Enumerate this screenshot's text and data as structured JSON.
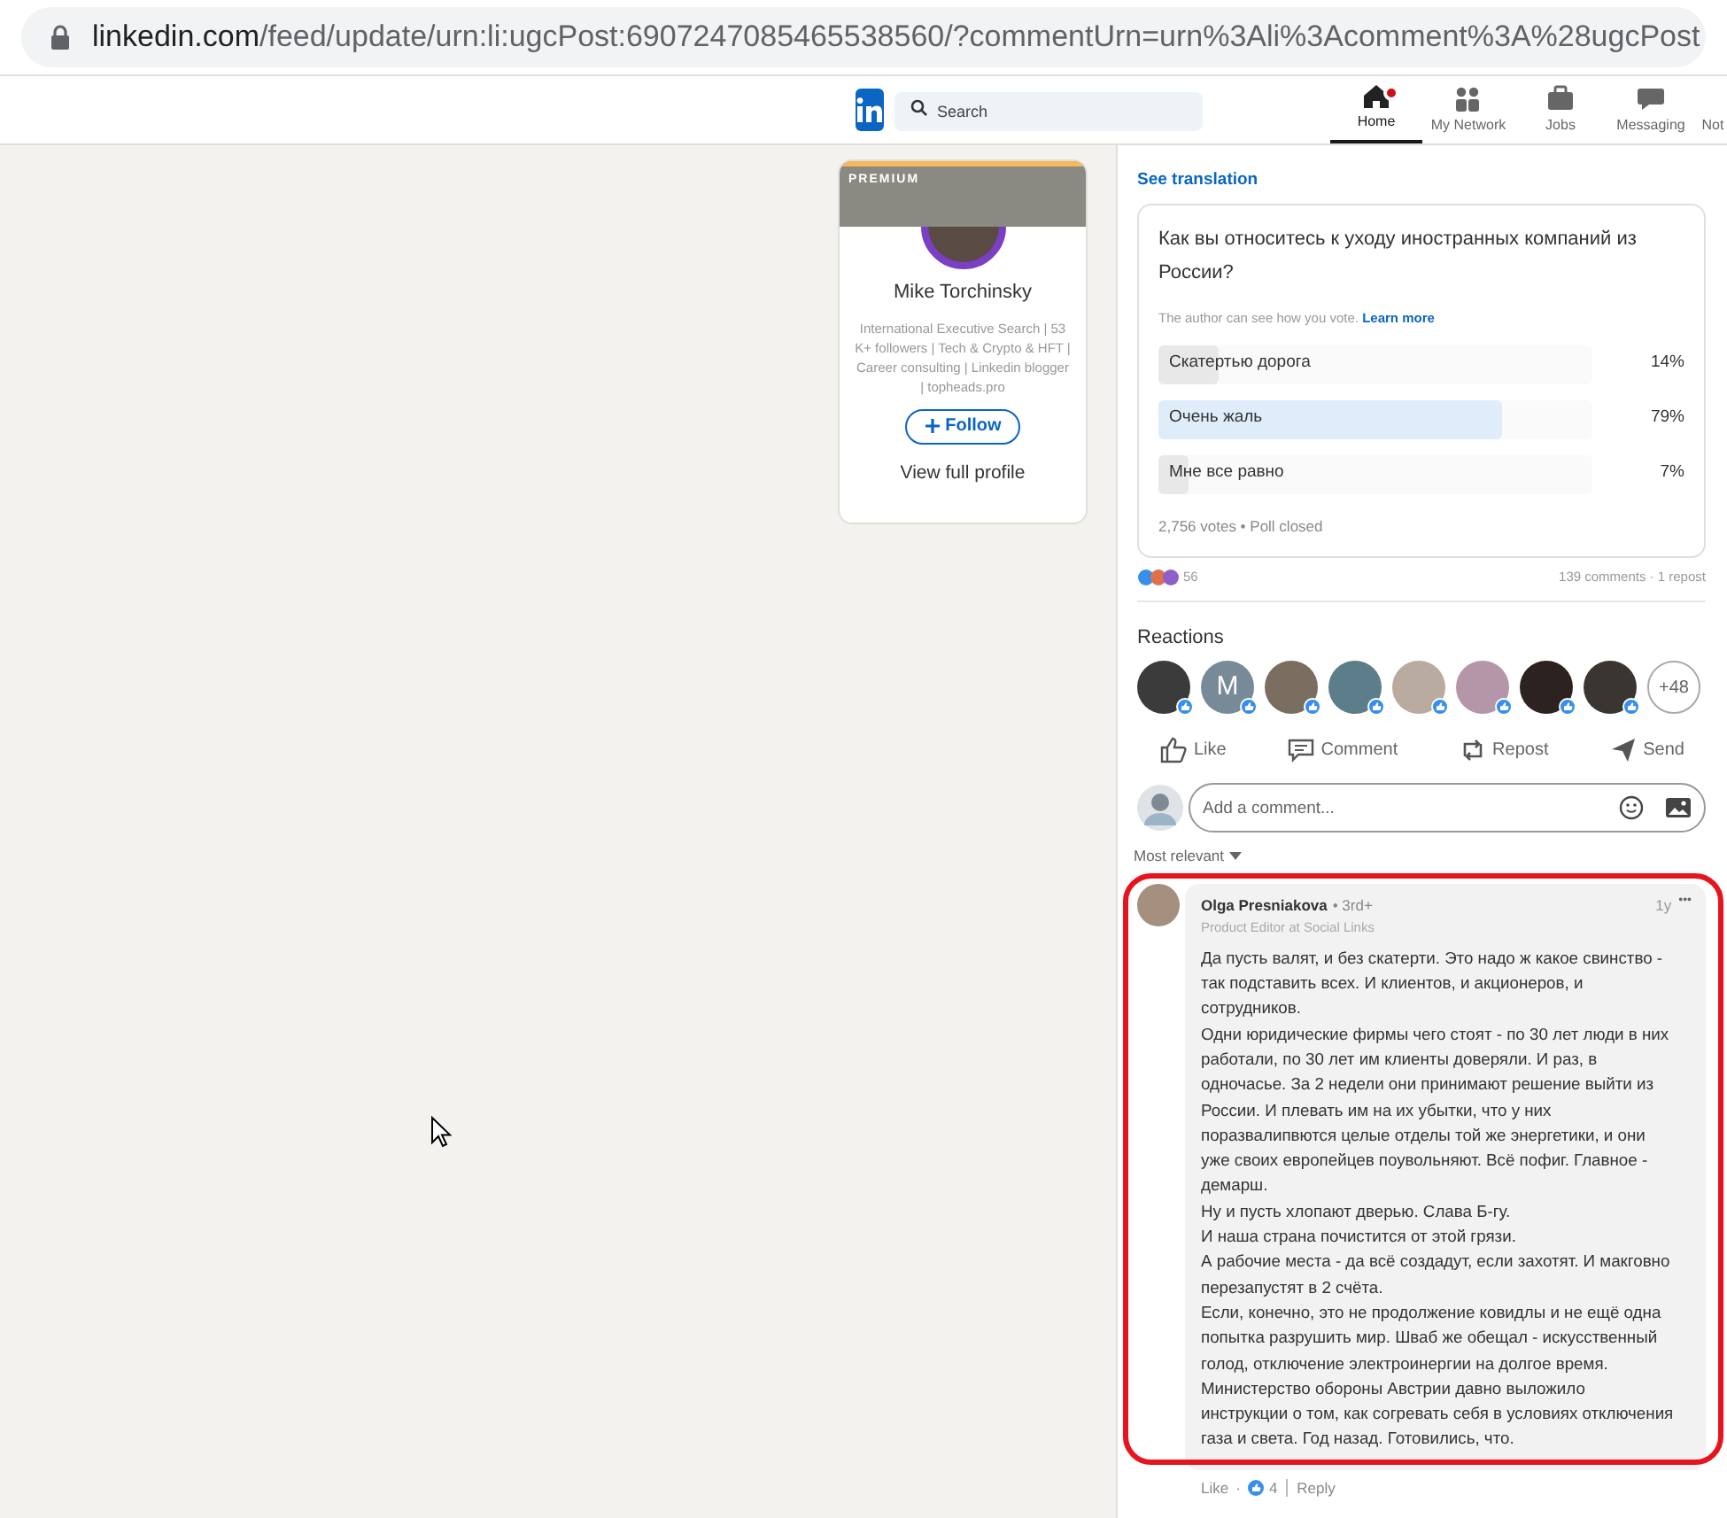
{
  "address_bar": {
    "url": "linkedin.com/feed/update/urn:li:ugcPost:6907247085465538560/?commentUrn=urn%3Ali%3Acomment%3A%28ugcPost"
  },
  "nav": {
    "search_placeholder": "Search",
    "items": [
      {
        "label": "Home",
        "selected": true,
        "badge": true
      },
      {
        "label": "My Network",
        "selected": false,
        "badge": false
      },
      {
        "label": "Jobs",
        "selected": false,
        "badge": false
      },
      {
        "label": "Messaging",
        "selected": false,
        "badge": false
      },
      {
        "label": "Not",
        "selected": false,
        "badge": false
      }
    ]
  },
  "profile_card": {
    "banner_label": "PREMIUM",
    "name": "Mike Torchinsky",
    "headline": "International Executive Search | 53 K+ followers | Tech & Crypto & HFT | Career consulting | Linkedin blogger | topheads.pro",
    "follow_button": "Follow",
    "view_profile": "View full profile"
  },
  "post": {
    "see_translation": "See translation",
    "poll": {
      "question": "Как вы относитесь к уходу иностранных компаний из России?",
      "note": "The author can see how you vote.",
      "learn_more": "Learn more",
      "options": [
        {
          "label": "Скатертью дорога",
          "percent": "14%",
          "level": 0.14,
          "selected": false
        },
        {
          "label": "Очень жаль",
          "percent": "79%",
          "level": 0.79,
          "selected": true
        },
        {
          "label": "Мне все равно",
          "percent": "7%",
          "level": 0.07,
          "selected": false
        }
      ],
      "footer": "2,756 votes • Poll closed"
    },
    "reaction_count": "56",
    "comments_reposts": "139 comments · 1 repost",
    "reactions_title": "Reactions",
    "reactors": [
      {
        "kind": "photo"
      },
      {
        "kind": "letter",
        "letter": "M"
      },
      {
        "kind": "photo"
      },
      {
        "kind": "photo"
      },
      {
        "kind": "photo"
      },
      {
        "kind": "photo"
      },
      {
        "kind": "photo"
      },
      {
        "kind": "photo"
      },
      {
        "kind": "more",
        "text": "+48"
      }
    ],
    "actions": [
      {
        "label": "Like"
      },
      {
        "label": "Comment"
      },
      {
        "label": "Repost"
      },
      {
        "label": "Send"
      }
    ],
    "comment_placeholder": "Add a comment...",
    "sort": "Most relevant"
  },
  "comment": {
    "author": "Olga Presniakova",
    "degree": "• 3rd+",
    "headline": "Product Editor at Social Links",
    "time": "1y",
    "menu": "•••",
    "highlighted": true,
    "paragraphs": [
      "Да пусть валят, и без скатерти. Это надо ж какое свинство - так подставить всех. И клиентов, и акционеров, и сотрудников.",
      "Одни юридические фирмы чего стоят - по 30 лет люди в них работали, по 30 лет им клиенты доверяли. И раз, в одночасье. За 2 недели они принимают решение выйти из России. И плевать им на их убытки, что у них поразвалипвются целые отделы той же энергетики, и они уже своих европейцев поувольняют. Всё пофиг. Главное - демарш.",
      "Ну и пусть хлопают дверью. Слава Б-гу.",
      "И наша страна почистится от этой грязи.",
      "А рабочие места - да всё создадут, если захотят. И макговно перезапустят в 2 счёта.",
      "Если, конечно, это не продолжение ковидлы и не ещё одна попытка разрушить мир. Шваб же обещал - искусственный голод, отключение электроинергии на долгое время.",
      "Министерство обороны Австрии давно выложило инструкции о том, как согревать себя в условиях отключения газа и света. Год назад. Готовились, что."
    ],
    "like": "Like",
    "separator": "·",
    "like_count": "4",
    "reply": "Reply"
  }
}
